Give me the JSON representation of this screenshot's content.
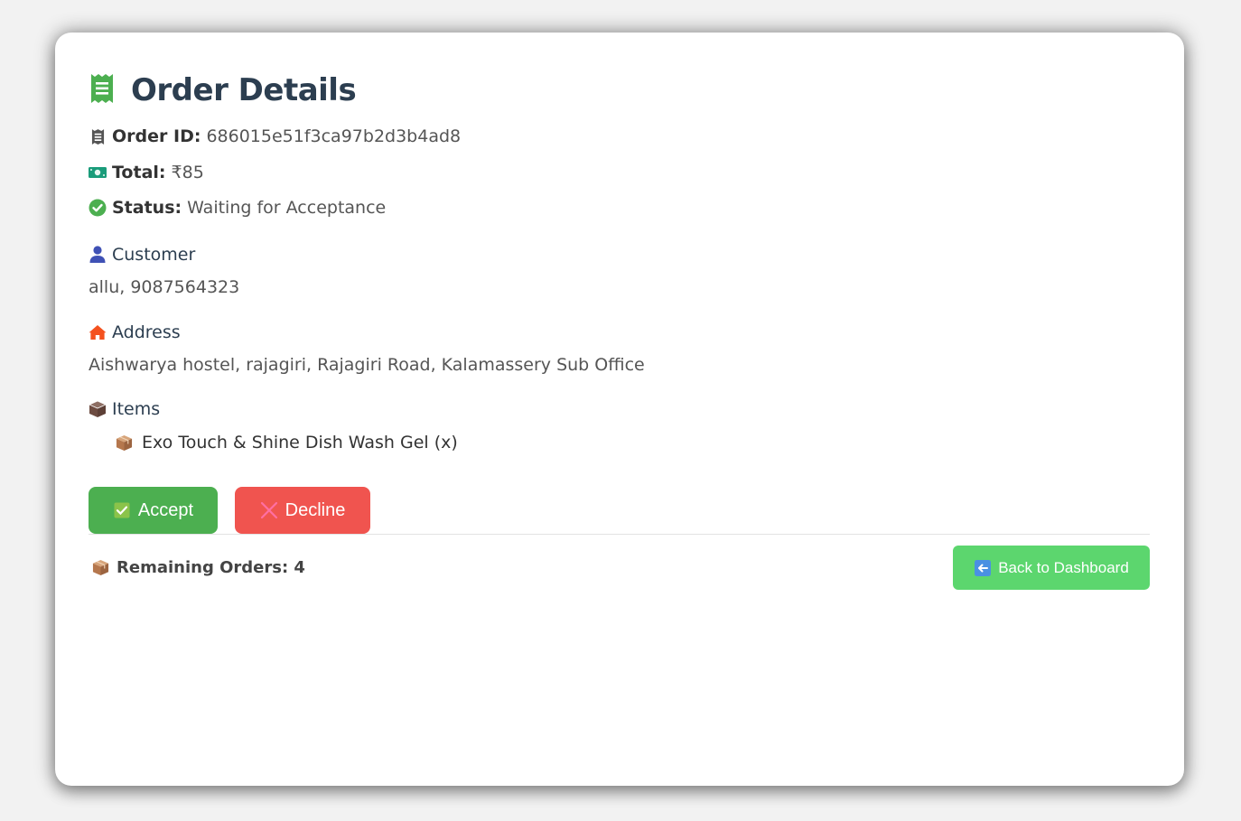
{
  "page": {
    "title": "Order Details"
  },
  "order": {
    "id_label": "Order ID:",
    "id_value": "686015e51f3ca97b2d3b4ad8",
    "total_label": "Total:",
    "total_value": "₹85",
    "status_label": "Status:",
    "status_value": "Waiting for Acceptance"
  },
  "customer": {
    "heading": "Customer",
    "value": "allu, 9087564323"
  },
  "address": {
    "heading": "Address",
    "value": "Aishwarya hostel, rajagiri, Rajagiri Road, Kalamassery Sub Office"
  },
  "items": {
    "heading": "Items",
    "list": [
      "Exo Touch & Shine Dish Wash Gel (x)"
    ]
  },
  "actions": {
    "accept_label": "Accept",
    "decline_label": "Decline",
    "back_label": "Back to Dashboard"
  },
  "footer": {
    "remaining_text": "Remaining Orders: 4"
  },
  "icons": {
    "title": "receipt-icon",
    "order_id": "receipt-icon",
    "total": "money-icon",
    "status": "check-circle-icon",
    "customer": "user-icon",
    "address": "home-icon",
    "items": "box-icon",
    "item": "package-icon",
    "accept": "check-box-icon",
    "decline": "cross-icon",
    "remaining": "package-icon",
    "back": "left-arrow-icon"
  },
  "colors": {
    "accept": "#4caf50",
    "decline": "#f0544f",
    "back": "#5cd66e",
    "title": "#2c3e50",
    "title_icon": "#4caf50"
  }
}
